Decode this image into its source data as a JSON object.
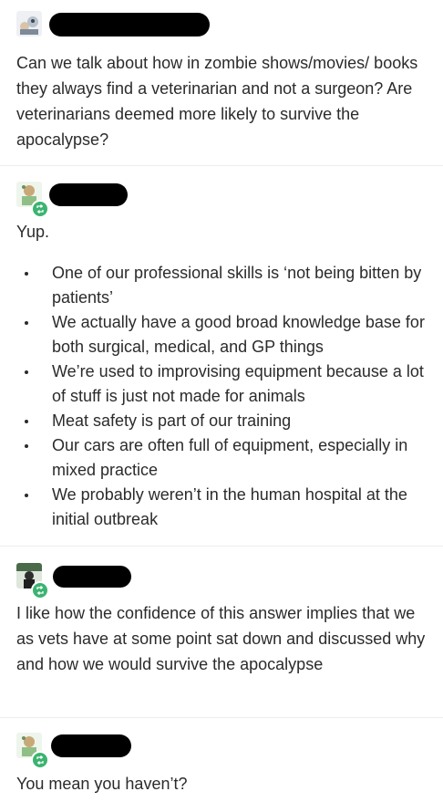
{
  "posts": [
    {
      "text": "Can we talk about how in zombie shows/movies/ books they always find a veterinarian and not a surgeon? Are veterinarians deemed more likely to survive the apocalypse?"
    },
    {
      "intro": "Yup.",
      "bullets": [
        "One of our professional skills is ‘not being bitten by patients’",
        "We actually have a good broad knowledge base for both surgical, medical, and GP things",
        "We’re used to improvising equipment because a lot of stuff is just not made for animals",
        "Meat safety is part of our training",
        "Our cars are often full of equipment, especially in mixed practice",
        "We probably weren’t in the human hospital at the initial outbreak"
      ]
    },
    {
      "text": "I like how the confidence of this answer implies that we as vets have at some point sat down and discussed why and how we would survive the apocalypse"
    },
    {
      "text": "You mean you haven’t?"
    }
  ],
  "icons": {
    "reblog": "reblog-icon",
    "avatar": "avatar-icon"
  },
  "colors": {
    "reblog_green": "#3cb371",
    "text": "#2b2b2b",
    "divider": "#ececec"
  }
}
